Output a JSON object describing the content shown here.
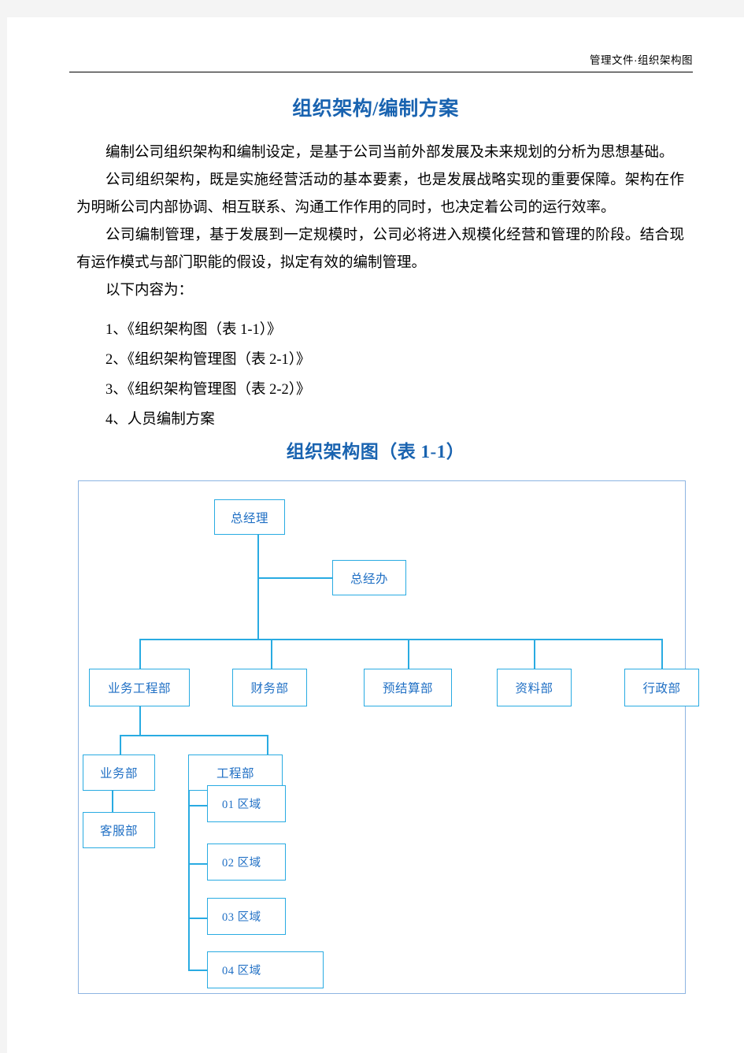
{
  "header": {
    "running_head": "管理文件·组织架构图"
  },
  "document": {
    "title": "组织架构/编制方案",
    "paragraphs": [
      "编制公司组织架构和编制设定，是基于公司当前外部发展及未来规划的分析为思想基础。",
      "公司组织架构，既是实施经营活动的基本要素，也是发展战略实现的重要保障。架构在作为明晰公司内部协调、相互联系、沟通工作作用的同时，也决定着公司的运行效率。",
      "公司编制管理，基于发展到一定规模时，公司必将进入规模化经营和管理的阶段。结合现有运作模式与部门职能的假设，拟定有效的编制管理。",
      "以下内容为："
    ],
    "list_items": [
      "1、《组织架构图（表 1-1）》",
      "2、《组织架构管理图（表 2-1）》",
      "3、《组织架构管理图（表 2-2）》",
      "4、人员编制方案"
    ],
    "section_title": "组织架构图（表 1-1）"
  },
  "org_chart": {
    "colors": {
      "node_border": "#29abe2",
      "node_text": "#1f6fc4",
      "connector": "#29abe2",
      "frame_border": "#8db4e2"
    },
    "nodes": {
      "general_manager": "总经理",
      "gm_office": "总经办",
      "dept_business_engineering": "业务工程部",
      "dept_finance": "财务部",
      "dept_budget": "预结算部",
      "dept_archives": "资料部",
      "dept_administration": "行政部",
      "sub_business": "业务部",
      "sub_customer_service": "客服部",
      "sub_engineering": "工程部",
      "region_01": "01 区域",
      "region_02": "02 区域",
      "region_03": "03 区域",
      "region_04": "04 区域"
    }
  }
}
